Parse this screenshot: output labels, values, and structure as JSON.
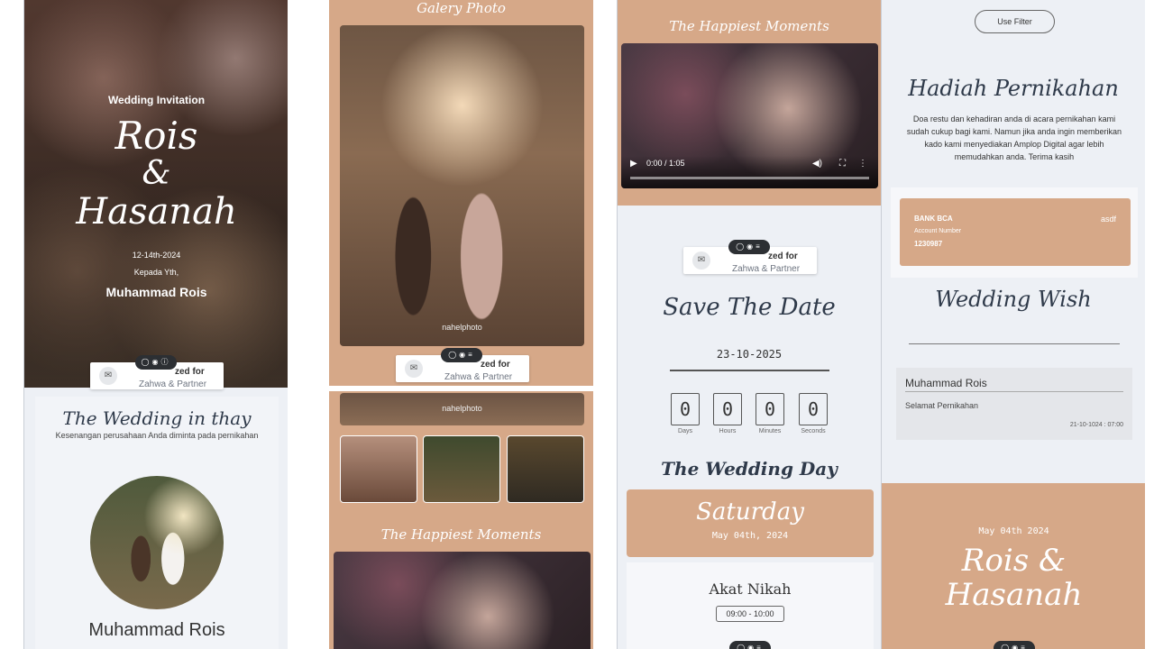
{
  "panel1": {
    "hero": {
      "subtitle": "Wedding Invitation",
      "name1": "Rois",
      "amp": "&",
      "name2": "Hasanah",
      "date": "12-14th-2024",
      "to_label": "Kepada Yth,",
      "guest": "Muhammad Rois"
    },
    "floatbar": {
      "title": "zed for",
      "guest": "Zahwa & Partner"
    },
    "section": {
      "title": "The Wedding in thay",
      "subtitle": "Kesenangan perusahaan Anda diminta pada pernikahan",
      "name": "Muhammad Rois"
    }
  },
  "panel2": {
    "gallery_title": "Galery Photo",
    "watermark": "nahelphoto",
    "floatbar": {
      "title": "zed for",
      "guest": "Zahwa & Partner"
    },
    "moments_title": "The Happiest Moments"
  },
  "panel3": {
    "moments_title": "The Happiest Moments",
    "video_time": "0:00 / 1:05",
    "floatbar": {
      "title": "zed for",
      "guest": "Zahwa & Partner"
    },
    "save_date_title": "Save The Date",
    "save_date_value": "23-10-2025",
    "countdown": [
      {
        "value": "0",
        "label": "Days"
      },
      {
        "value": "0",
        "label": "Hours"
      },
      {
        "value": "0",
        "label": "Minutes"
      },
      {
        "value": "0",
        "label": "Seconds"
      }
    ],
    "wedding_day_title": "The Wedding Day",
    "day_name": "Saturday",
    "day_date": "May 04th, 2024",
    "event_name": "Akat Nikah",
    "event_time": "09:00 - 10:00"
  },
  "panel4": {
    "filter_button": "Use Filter",
    "gift_title": "Hadiah Pernikahan",
    "gift_text": "Doa restu dan kehadiran anda di acara pernikahan kami sudah cukup bagi kami. Namun jika anda ingin memberikan kado kami menyediakan Amplop Digital agar lebih memudahkan anda. Terima kasih",
    "bank": {
      "name": "BANK BCA",
      "holder": "asdf",
      "label": "Account Number",
      "number": "1230987"
    },
    "wish_title": "Wedding Wish",
    "wish": {
      "name": "Muhammad Rois",
      "message": "Selamat Pernikahan",
      "time": "21-10-1024 : 07:00"
    },
    "footer": {
      "date": "May 04th 2024",
      "name1": "Rois &",
      "name2": "Hasanah"
    }
  },
  "colors": {
    "accent": "#d6a888",
    "panel_bg": "#edf0f5",
    "text_dark": "#2f3a4a"
  }
}
